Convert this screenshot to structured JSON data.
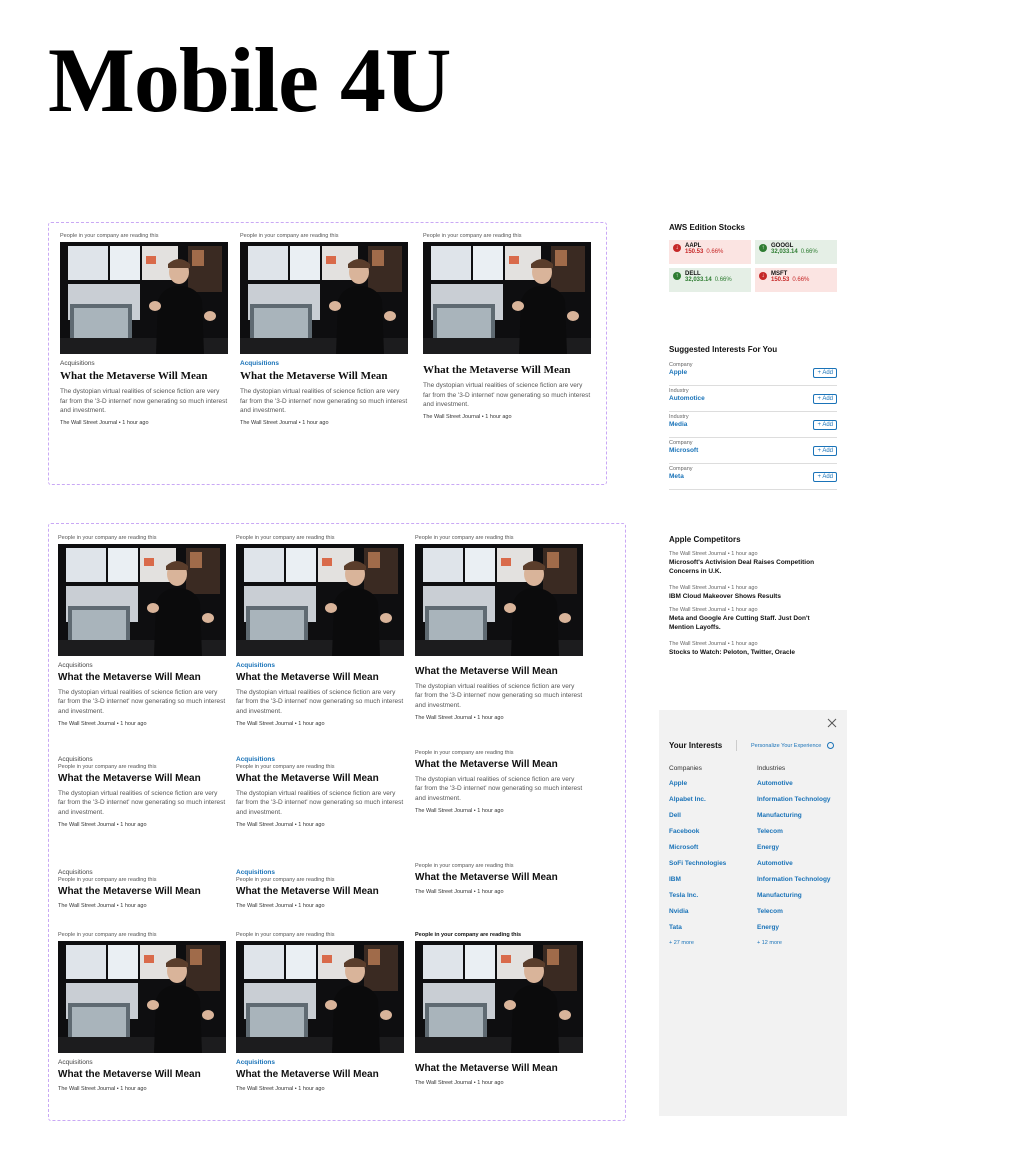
{
  "page": {
    "title": "Mobile 4U"
  },
  "article": {
    "reading_label": "People in your company are reading this",
    "category": "Acquisitions",
    "headline": "What the Metaverse Will Mean",
    "description": "The dystopian virtual realities of science fiction are very far from the '3-D internet' now generating so much interest and investment.",
    "source": "The Wall Street Journal",
    "time": "1 hour ago",
    "image_alt": "Man speaking in front of screens"
  },
  "stocks": {
    "title": "AWS Edition Stocks",
    "items": [
      {
        "symbol": "AAPL",
        "price": "150.53",
        "change": "0.66%",
        "direction": "down"
      },
      {
        "symbol": "GOOGL",
        "price": "32,033.14",
        "change": "0.66%",
        "direction": "up"
      },
      {
        "symbol": "DELL",
        "price": "32,033.14",
        "change": "0.66%",
        "direction": "up"
      },
      {
        "symbol": "MSFT",
        "price": "150.53",
        "change": "0.66%",
        "direction": "down"
      }
    ]
  },
  "suggested": {
    "title": "Suggested Interests For You",
    "add_label": "+ Add",
    "items": [
      {
        "type": "Company",
        "name": "Apple"
      },
      {
        "type": "Industry",
        "name": "Automotice"
      },
      {
        "type": "Industry",
        "name": "Media"
      },
      {
        "type": "Company",
        "name": "Microsoft"
      },
      {
        "type": "Company",
        "name": "Meta"
      }
    ]
  },
  "competitors": {
    "title": "Apple Competitors",
    "source": "The Wall Street Journal",
    "time": "1 hour ago",
    "items": [
      "Microsoft's Activision Deal Raises Competition Concerns in U.K.",
      "IBM Cloud Makeover Shows Results",
      "Meta and Google Are Cutting Staff. Just Don't Mention Layoffs.",
      "Stocks to Watch: Peloton, Twitter, Oracle"
    ]
  },
  "interests": {
    "title": "Your Interests",
    "personalize_label": "Personalize Your Experience",
    "companies_header": "Companies",
    "industries_header": "Industries",
    "companies": [
      "Apple",
      "Alpabet Inc.",
      "Dell",
      "Facebook",
      "Microsoft",
      "SoFi Technologies",
      "IBM",
      "Tesla Inc.",
      "Nvidia",
      "Tata"
    ],
    "industries": [
      "Automotive",
      "Information Technology",
      "Manufacturing",
      "Telecom",
      "Energy",
      "Automotive",
      "Information Technology",
      "Manufacturing",
      "Telecom",
      "Energy"
    ],
    "companies_more": "+ 27 more",
    "industries_more": "+ 12 more"
  },
  "colors": {
    "accent": "#1a73b8",
    "down": "#c62828",
    "up": "#2e7d32",
    "dash": "#c9a8f5"
  }
}
